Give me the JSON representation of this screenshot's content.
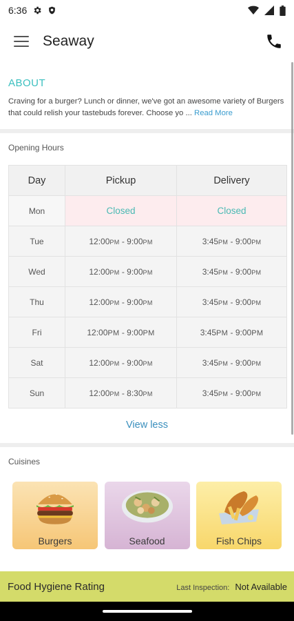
{
  "status": {
    "time": "6:36",
    "left_icons": [
      "gear-icon",
      "shield-icon"
    ],
    "right_icons": [
      "wifi-icon",
      "signal-icon",
      "battery-icon"
    ]
  },
  "appbar": {
    "title": "Seaway",
    "menu_icon": "hamburger-icon",
    "call_icon": "phone-icon"
  },
  "about": {
    "title": "ABOUT",
    "text": "Craving for a burger? Lunch or dinner, we've got an awesome variety of Burgers that could relish your tastebuds forever. Choose yo ... ",
    "read_more": "Read More"
  },
  "hours": {
    "label": "Opening Hours",
    "headers": {
      "day": "Day",
      "pickup": "Pickup",
      "delivery": "Delivery"
    },
    "rows": [
      {
        "day": "Mon",
        "closed": true,
        "pickup": "Closed",
        "delivery": "Closed"
      },
      {
        "day": "Tue",
        "pickup": [
          "12:00",
          "PM",
          " - 9:00",
          "PM"
        ],
        "delivery": [
          "3:45",
          "PM",
          " - 9:00",
          "PM"
        ]
      },
      {
        "day": "Wed",
        "pickup": [
          "12:00",
          "PM",
          " - 9:00",
          "PM"
        ],
        "delivery": [
          "3:45",
          "PM",
          " - 9:00",
          "PM"
        ]
      },
      {
        "day": "Thu",
        "pickup": [
          "12:00",
          "PM",
          " - 9:00",
          "PM"
        ],
        "delivery": [
          "3:45",
          "PM",
          " - 9:00",
          "PM"
        ]
      },
      {
        "day": "Fri",
        "today": true,
        "pickup": [
          "12:00",
          "PM",
          " - 9:00",
          "PM"
        ],
        "delivery": [
          "3:45",
          "PM",
          " - 9:00",
          "PM"
        ]
      },
      {
        "day": "Sat",
        "pickup": [
          "12:00",
          "PM",
          " - 9:00",
          "PM"
        ],
        "delivery": [
          "3:45",
          "PM",
          " - 9:00",
          "PM"
        ]
      },
      {
        "day": "Sun",
        "pickup": [
          "12:00",
          "PM",
          " - 8:30",
          "PM"
        ],
        "delivery": [
          "3:45",
          "PM",
          " - 9:00",
          "PM"
        ]
      }
    ],
    "view_less": "View less"
  },
  "cuisines": {
    "label": "Cuisines",
    "items": [
      {
        "name": "Burgers",
        "icon": "burger-image"
      },
      {
        "name": "Seafood",
        "icon": "seafood-bowl-image"
      },
      {
        "name": "Fish  Chips",
        "icon": "fish-and-chips-image"
      }
    ]
  },
  "hygiene": {
    "title": "Food Hygiene Rating",
    "inspection_label": "Last Inspection:",
    "inspection_value": "Not Available"
  },
  "colors": {
    "accent_teal": "#3bbfbf",
    "link_blue": "#3a9ccf",
    "closed_bg": "#fdecee",
    "hygiene_bg": "#d4db6a"
  }
}
